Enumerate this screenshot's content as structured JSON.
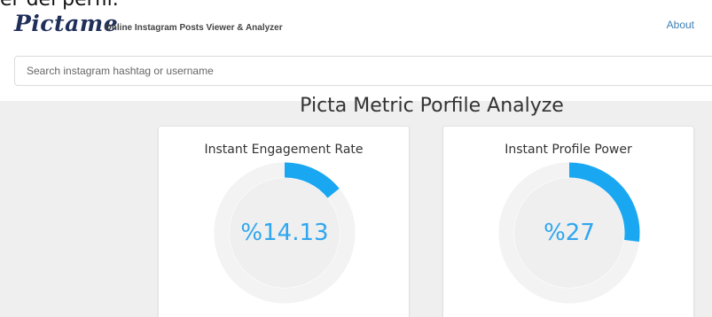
{
  "fragment": {
    "text": "er del perfil."
  },
  "header": {
    "logo": "Pictame",
    "tagline": "Online Instagram Posts Viewer & Analyzer",
    "about_label": "About"
  },
  "search": {
    "placeholder": "Search instagram hashtag or username"
  },
  "page_title": "Picta Metric Porfile Analyze",
  "colors": {
    "gauge_fill": "#1aa7f2",
    "gauge_track": "#f3f3f3",
    "gauge_inner": "#efefef",
    "value_text": "#2fa6ef",
    "logo": "#1f2f5a",
    "link": "#3f7fb4"
  },
  "metrics": [
    {
      "title": "Instant Engagement Rate",
      "value_text": "%14.13",
      "percent": 14.13
    },
    {
      "title": "Instant Profile Power",
      "value_text": "%27",
      "percent": 27
    }
  ]
}
